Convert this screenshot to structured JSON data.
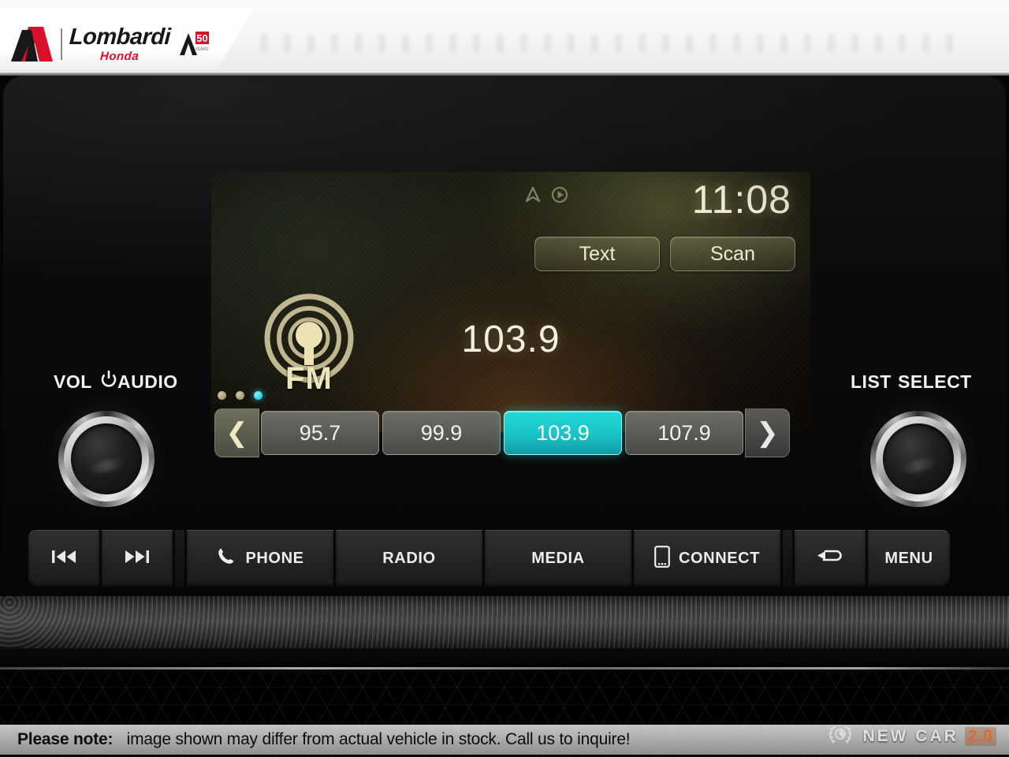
{
  "dealer": {
    "name": "Lombardi",
    "brand": "Honda",
    "badge_text": "50",
    "badge_sub": "YEARS",
    "logo_icon": "lombardi-a-mark"
  },
  "screen": {
    "clock": "11:08",
    "status_icons": [
      "navigation-arrow-icon",
      "play-circle-icon"
    ],
    "top_buttons": [
      {
        "label": "Text",
        "name": "text-button"
      },
      {
        "label": "Scan",
        "name": "scan-button"
      }
    ],
    "source_badge": {
      "label": "FM",
      "icon": "radio-broadcast-icon"
    },
    "frequency": "103.9",
    "presets": {
      "prev_icon": "chevron-left-icon",
      "next_icon": "chevron-right-icon",
      "pages": 3,
      "active_page": 3,
      "items": [
        {
          "label": "95.7",
          "active": false
        },
        {
          "label": "99.9",
          "active": false
        },
        {
          "label": "103.9",
          "active": true
        },
        {
          "label": "107.9",
          "active": false
        }
      ]
    },
    "accent_color": "#1ac8cb",
    "text_color": "#f2efda"
  },
  "controls": {
    "left": {
      "label_vol": "VOL",
      "label_audio": "AUDIO",
      "power_icon": "power-icon",
      "knob": "volume-knob"
    },
    "right": {
      "label_list": "LIST",
      "label_select": "SELECT",
      "knob": "select-knob"
    }
  },
  "buttons": [
    {
      "name": "previous-track-button",
      "label": "",
      "icon": "skip-back-icon",
      "size": "sm"
    },
    {
      "name": "next-track-button",
      "label": "",
      "icon": "skip-forward-icon",
      "size": "sm"
    },
    {
      "name": "phone-button",
      "label": "PHONE",
      "icon": "phone-handset-icon",
      "size": "md"
    },
    {
      "name": "radio-button",
      "label": "RADIO",
      "icon": "",
      "size": "md"
    },
    {
      "name": "media-button",
      "label": "MEDIA",
      "icon": "",
      "size": "md"
    },
    {
      "name": "connect-button",
      "label": "CONNECT",
      "icon": "smartphone-icon",
      "size": "md"
    },
    {
      "name": "back-button",
      "label": "",
      "icon": "back-arrow-icon",
      "size": "sm"
    },
    {
      "name": "menu-button",
      "label": "MENU",
      "icon": "",
      "size": "sm"
    }
  ],
  "footer": {
    "note_label": "Please note:",
    "note_body": "image shown may differ from actual vehicle in stock. Call us to inquire!",
    "watermark_text": "NEW CAR",
    "watermark_version": "2.0",
    "watermark_icon": "laurel-wreath-icon"
  }
}
